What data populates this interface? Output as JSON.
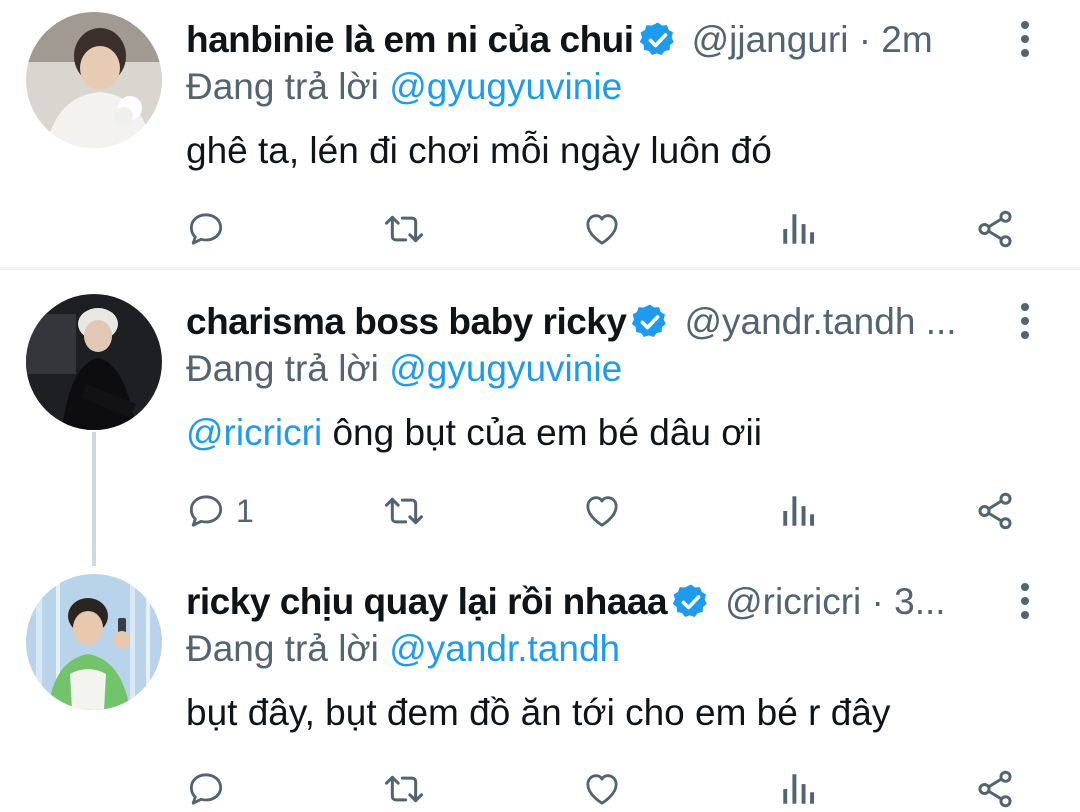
{
  "tweets": [
    {
      "display_name": "hanbinie là em ni của chui",
      "handle_time": "@jjanguri · 2m",
      "reply_prefix": "Đang trả lời",
      "reply_to": "@gyugyuvinie",
      "mention": "",
      "text": "ghê ta, lén đi chơi mỗi ngày luôn đó",
      "reply_count": "",
      "avatar_icon": "avatar-photo"
    },
    {
      "display_name": "charisma boss baby ricky",
      "handle_time": "@yandr.tandh ...",
      "reply_prefix": "Đang trả lời",
      "reply_to": "@gyugyuvinie",
      "mention": "@ricricri",
      "text": " ông bụt của em bé dâu ơii",
      "reply_count": "1",
      "avatar_icon": "avatar-photo"
    },
    {
      "display_name": "ricky chịu quay lại rồi nhaaa",
      "handle_time": "@ricricri · 3...",
      "reply_prefix": "Đang trả lời",
      "reply_to": "@yandr.tandh",
      "mention": "",
      "text": "bụt đây, bụt đem đồ ăn tới cho em bé r đây",
      "reply_count": "",
      "avatar_icon": "avatar-photo"
    }
  ],
  "icons": {
    "reply": "speech-bubble-icon",
    "retweet": "retweet-icon",
    "like": "heart-icon",
    "views": "bar-chart-icon",
    "share": "share-icon",
    "verified": "verified-badge-icon",
    "more": "vertical-dots-icon"
  },
  "colors": {
    "accent": "#1d9bf0",
    "secondary_text": "#536471",
    "primary_text": "#0f1419",
    "icon_gray": "#536471",
    "divider": "#eff3f4"
  }
}
